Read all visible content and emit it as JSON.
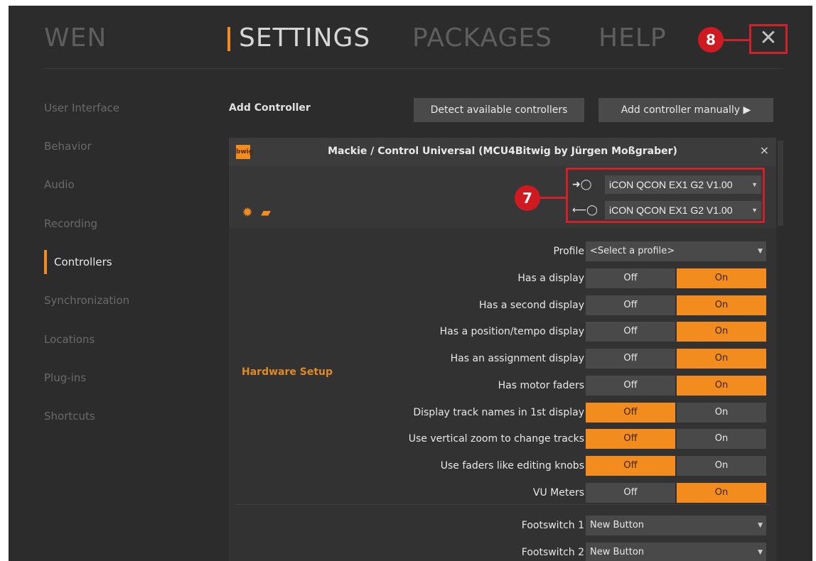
{
  "topnav": {
    "wen": "WEN",
    "settings": "SETTINGS",
    "packages": "PACKAGES",
    "help": "HELP",
    "close": "✕"
  },
  "annotations": {
    "badge_8": "8",
    "badge_7": "7"
  },
  "sidebar": {
    "items": [
      {
        "label": "User Interface",
        "active": false
      },
      {
        "label": "Behavior",
        "active": false
      },
      {
        "label": "Audio",
        "active": false
      },
      {
        "label": "Recording",
        "active": false
      },
      {
        "label": "Controllers",
        "active": true
      },
      {
        "label": "Synchronization",
        "active": false
      },
      {
        "label": "Locations",
        "active": false
      },
      {
        "label": "Plug-ins",
        "active": false
      },
      {
        "label": "Shortcuts",
        "active": false
      }
    ]
  },
  "add_controller": {
    "label": "Add Controller",
    "detect": "Detect available controllers",
    "manual": "Add controller manually ▶"
  },
  "controller": {
    "logo": "bwig",
    "title": "Mackie / Control Universal (MCU4Bitwig by Jürgen Moßgraber)",
    "close": "×",
    "input_arrow": "➜◯",
    "output_arrow": "⟵◯",
    "input_port": "iCON QCON EX1 G2 V1.00",
    "output_port": "iCON QCON EX1 G2 V1.00"
  },
  "hardware_setup": {
    "section": "Hardware Setup",
    "profile_label": "Profile",
    "profile_value": "<Select a profile>",
    "off_label": "Off",
    "on_label": "On",
    "toggles": [
      {
        "label": "Has a display",
        "value": "On"
      },
      {
        "label": "Has a second display",
        "value": "On"
      },
      {
        "label": "Has a position/tempo display",
        "value": "On"
      },
      {
        "label": "Has an assignment display",
        "value": "On"
      },
      {
        "label": "Has motor faders",
        "value": "On"
      },
      {
        "label": "Display track names in 1st display",
        "value": "Off"
      },
      {
        "label": "Use vertical zoom to change tracks",
        "value": "Off"
      },
      {
        "label": "Use faders like editing knobs",
        "value": "Off"
      },
      {
        "label": "VU Meters",
        "value": "On"
      }
    ],
    "footswitches": [
      {
        "label": "Footswitch 1",
        "value": "New Button"
      },
      {
        "label": "Footswitch 2",
        "value": "New Button"
      }
    ]
  },
  "colors": {
    "accent": "#f28c1e",
    "annotation_red": "#d0202a",
    "background": "#2c2c2c"
  }
}
